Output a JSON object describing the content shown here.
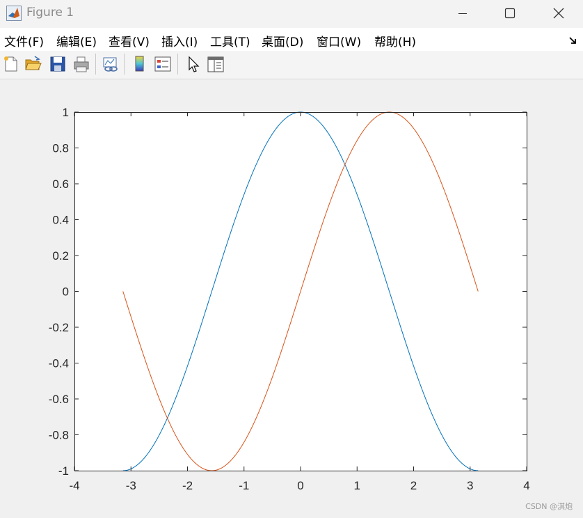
{
  "window": {
    "title": "Figure 1"
  },
  "menu": [
    "文件(F)",
    "编辑(E)",
    "查看(V)",
    "插入(I)",
    "工具(T)",
    "桌面(D)",
    "窗口(W)",
    "帮助(H)"
  ],
  "toolbar": {
    "icons": [
      "new-figure-icon",
      "open-file-icon",
      "save-icon",
      "print-icon",
      "link-plot-icon",
      "colorbar-icon",
      "legend-icon",
      "pointer-icon",
      "property-inspector-icon"
    ]
  },
  "chart_data": {
    "type": "line",
    "title": "",
    "xlabel": "",
    "ylabel": "",
    "xlim": [
      -4,
      4
    ],
    "ylim": [
      -1,
      1
    ],
    "xticks": [
      "-4",
      "-3",
      "-2",
      "-1",
      "0",
      "1",
      "2",
      "3",
      "4"
    ],
    "yticks": [
      "-1",
      "-0.8",
      "-0.6",
      "-0.4",
      "-0.2",
      "0",
      "0.2",
      "0.4",
      "0.6",
      "0.8",
      "1"
    ],
    "grid": false,
    "series": [
      {
        "function": "cos",
        "color": "#0072bd",
        "x": [
          -3.1416,
          -2.618,
          -2.0944,
          -1.5708,
          -1.0472,
          -0.5236,
          0,
          0.5236,
          1.0472,
          1.5708,
          2.0944,
          2.618,
          3.1416
        ],
        "y": [
          -1,
          -0.866,
          -0.5,
          0,
          0.5,
          0.866,
          1,
          0.866,
          0.5,
          0,
          -0.5,
          -0.866,
          -1
        ]
      },
      {
        "function": "sin",
        "color": "#d95319",
        "x": [
          -3.1416,
          -2.618,
          -2.0944,
          -1.5708,
          -1.0472,
          -0.5236,
          0,
          0.5236,
          1.0472,
          1.5708,
          2.0944,
          2.618,
          3.1416
        ],
        "y": [
          0,
          -0.5,
          -0.866,
          -1,
          -0.866,
          -0.5,
          0,
          0.5,
          0.866,
          1,
          0.866,
          0.5,
          0
        ]
      }
    ]
  },
  "watermark": "CSDN @淇炮"
}
